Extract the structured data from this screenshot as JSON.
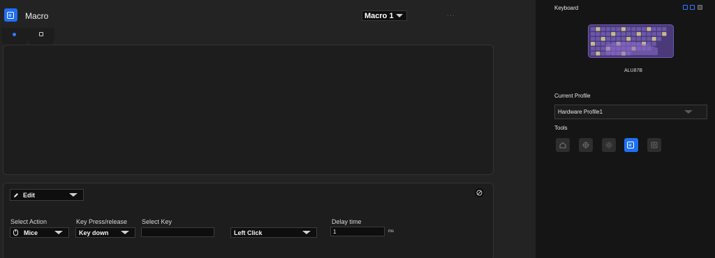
{
  "header": {
    "title": "Macro",
    "macro_select": "Macro 1",
    "more_label": "···"
  },
  "editor": {
    "mode_select": "Edit",
    "select_action_label": "Select Action",
    "select_action_value": "Mice",
    "key_press_label": "Key Press/release",
    "key_press_value": "Key down",
    "select_key_label": "Select Key",
    "select_key_value": "",
    "mouse_button_value": "Left Click",
    "delay_label": "Delay time",
    "delay_value": "1",
    "delay_unit": "ms"
  },
  "sidebar": {
    "keyboard_label": "Keyboard",
    "keyboard_name": "ALU87B",
    "current_profile_label": "Current Profile",
    "current_profile_value": "Hardware Profile1",
    "tools_label": "Tools",
    "tools": [
      "home-icon",
      "crosshair-icon",
      "sun-icon",
      "macro-icon",
      "settings-icon"
    ],
    "active_tool": "macro-icon"
  },
  "colors": {
    "accent": "#1f6ff2",
    "background": "#232323",
    "panel": "#1c1d1c",
    "sidebar": "#151515"
  }
}
